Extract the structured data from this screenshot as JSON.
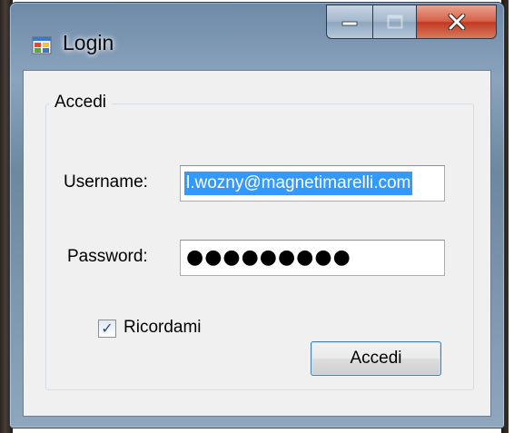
{
  "window": {
    "title": "Login",
    "controls": [
      "minimize-icon",
      "maximize-icon",
      "close-icon"
    ]
  },
  "group": {
    "legend": "Accedi"
  },
  "username": {
    "label": "Username:",
    "value": "l.wozny@magnetimarelli.com",
    "selected": true
  },
  "password": {
    "label": "Password:",
    "masked_value": "●●●●●●●●●"
  },
  "remember": {
    "label": "Ricordami",
    "checked": true,
    "check_glyph": "✓"
  },
  "submit": {
    "label": "Accedi"
  },
  "colors": {
    "selection": "#3399ff",
    "close_button": "#c23a22",
    "client_background": "#f0f0f0"
  }
}
